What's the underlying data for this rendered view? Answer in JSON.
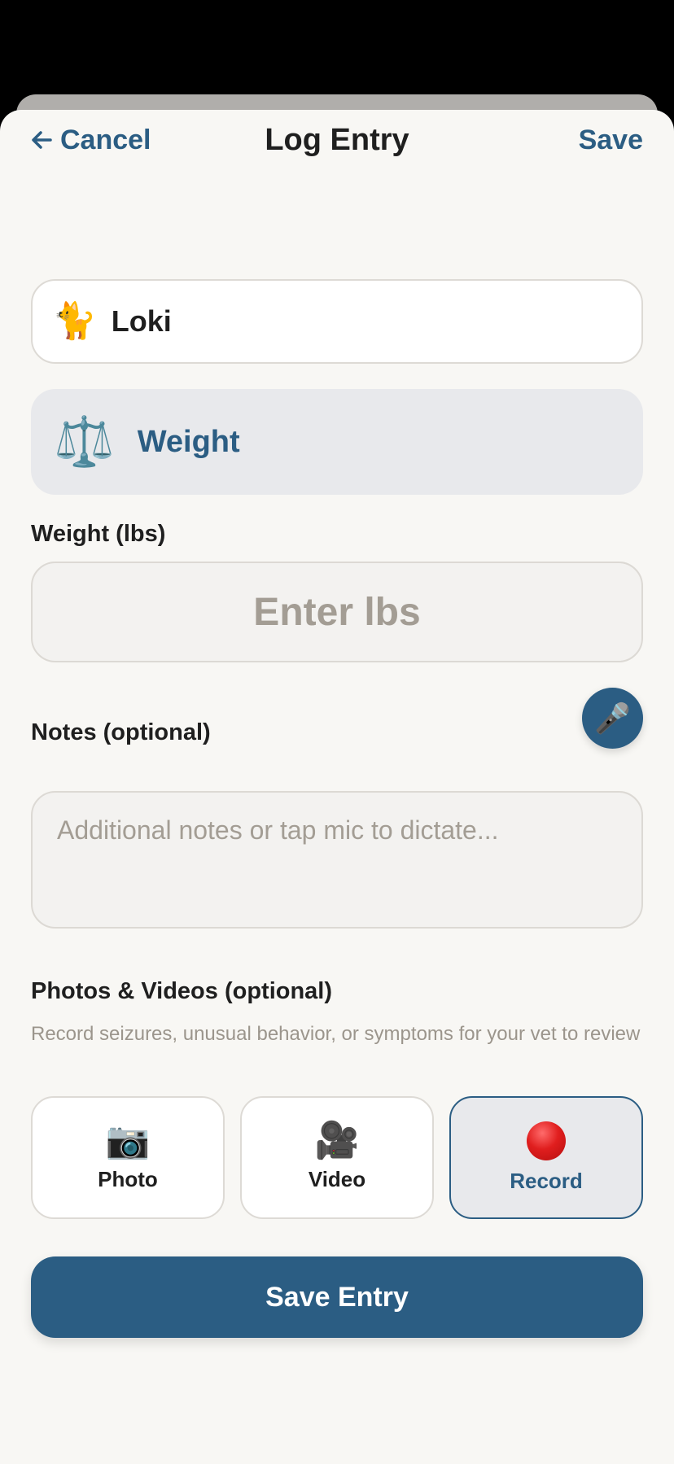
{
  "nav": {
    "cancel_label": "Cancel",
    "title": "Log Entry",
    "save_label": "Save"
  },
  "pet": {
    "icon": "🐈",
    "icon_name": "cat-icon",
    "name": "Loki"
  },
  "entry_type": {
    "icon": "⚖️",
    "icon_name": "scale-icon",
    "label": "Weight"
  },
  "weight": {
    "label": "Weight (lbs)",
    "value": "",
    "placeholder": "Enter lbs"
  },
  "notes": {
    "label": "Notes (optional)",
    "value": "",
    "placeholder": "Additional notes or tap mic to dictate...",
    "mic_icon": "🎤"
  },
  "media": {
    "label": "Photos & Videos (optional)",
    "help": "Record seizures, unusual behavior, or symptoms for your vet to review",
    "buttons": [
      {
        "icon": "📷",
        "icon_name": "camera-icon",
        "label": "Photo"
      },
      {
        "icon": "🎥",
        "icon_name": "video-camera-icon",
        "label": "Video"
      },
      {
        "icon": "",
        "icon_name": "record-icon",
        "label": "Record",
        "selected": true
      }
    ]
  },
  "save_entry_label": "Save Entry",
  "colors": {
    "accent": "#2b5d83",
    "background": "#f8f7f4",
    "text": "#1f1f1f",
    "muted": "#9b958c",
    "record_red": "#e01e1e"
  }
}
